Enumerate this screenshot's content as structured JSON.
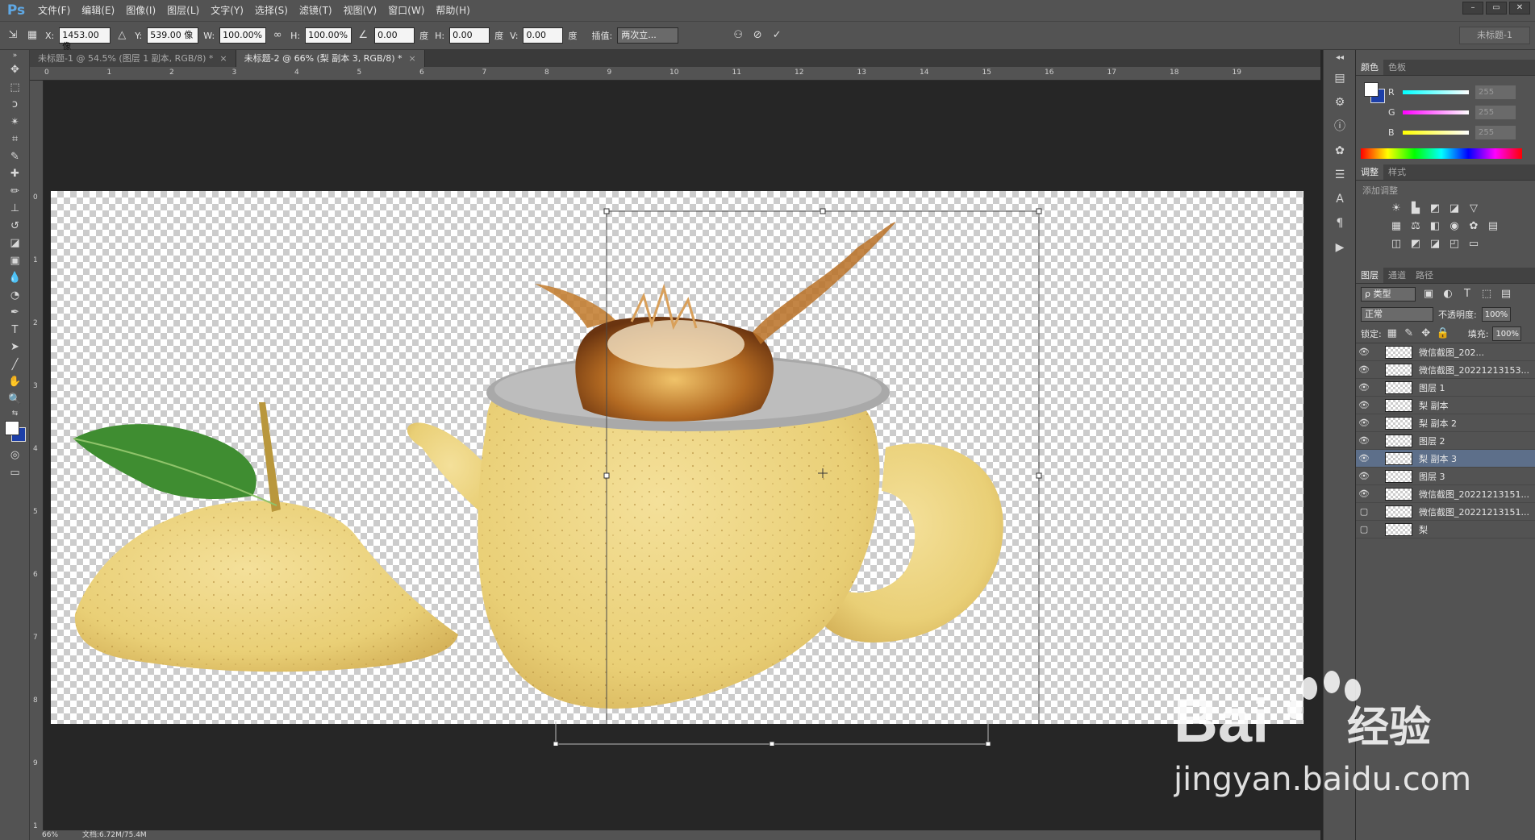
{
  "app": {
    "logo": "Ps"
  },
  "menu": [
    "文件(F)",
    "编辑(E)",
    "图像(I)",
    "图层(L)",
    "文字(Y)",
    "选择(S)",
    "滤镜(T)",
    "视图(V)",
    "窗口(W)",
    "帮助(H)"
  ],
  "window_controls": [
    "–",
    "▭",
    "✕"
  ],
  "options": {
    "x_label": "X:",
    "x_value": "1453.00 像",
    "y_label": "Y:",
    "y_value": "539.00 像",
    "w_label": "W:",
    "w_value": "100.00%",
    "h_label": "H:",
    "h_value": "100.00%",
    "angle_value": "0.00",
    "angle_unit": "度",
    "hskew_label": "H:",
    "hskew_value": "0.00",
    "hskew_unit": "度",
    "vskew_label": "V:",
    "vskew_value": "0.00",
    "vskew_unit": "度",
    "interp_label": "插值:",
    "interp_value": "两次立...",
    "workspace": "未标题-1"
  },
  "tabs": [
    {
      "label": "未标题-1 @ 54.5% (图层 1 副本, RGB/8) *",
      "close": "×"
    },
    {
      "label": "未标题-2 @ 66% (梨 副本 3, RGB/8) *",
      "close": "×"
    }
  ],
  "ruler_h": [
    "0",
    "1",
    "2",
    "3",
    "4",
    "5",
    "6",
    "7",
    "8",
    "9",
    "10",
    "11",
    "12",
    "13",
    "14",
    "15",
    "16",
    "17",
    "18",
    "19"
  ],
  "ruler_v": [
    "0",
    "1",
    "2",
    "3",
    "4",
    "5",
    "6",
    "7",
    "8",
    "9",
    "1"
  ],
  "status": {
    "zoom": "66%",
    "doc": "文档:6.72M/75.4M"
  },
  "color_panel": {
    "tabs": [
      "颜色",
      "色板"
    ],
    "channels": [
      {
        "label": "R",
        "value": "255"
      },
      {
        "label": "G",
        "value": "255"
      },
      {
        "label": "B",
        "value": "255"
      }
    ]
  },
  "adjust_panel": {
    "tabs": [
      "调整",
      "样式"
    ],
    "title": "添加调整"
  },
  "layers_panel": {
    "tabs": [
      "图层",
      "通道",
      "路径"
    ],
    "filter": "ρ 类型",
    "blend_mode": "正常",
    "opacity_label": "不透明度:",
    "opacity_value": "100%",
    "lock_label": "锁定:",
    "fill_label": "填充:",
    "fill_value": "100%",
    "layers": [
      {
        "name": "微信截图_202...",
        "visible": true
      },
      {
        "name": "微信截图_20221213153...",
        "visible": true
      },
      {
        "name": "图层 1",
        "visible": true
      },
      {
        "name": "梨 副本",
        "visible": true
      },
      {
        "name": "梨 副本 2",
        "visible": true
      },
      {
        "name": "图层 2",
        "visible": true
      },
      {
        "name": "梨 副本 3",
        "visible": true,
        "selected": true
      },
      {
        "name": "图层 3",
        "visible": true
      },
      {
        "name": "微信截图_20221213151...",
        "visible": true
      },
      {
        "name": "微信截图_20221213151...",
        "visible": false
      },
      {
        "name": "梨",
        "visible": false
      }
    ]
  },
  "watermark": {
    "brand": "Bai",
    "brand2": "经验",
    "url": "jingyan.baidu.com"
  },
  "colors": {
    "pear": "#e9cf76",
    "pear_dark": "#d9b95c",
    "leaf": "#3c8a2e",
    "tea": "#a8581a",
    "accent": "#5fa9e6"
  }
}
